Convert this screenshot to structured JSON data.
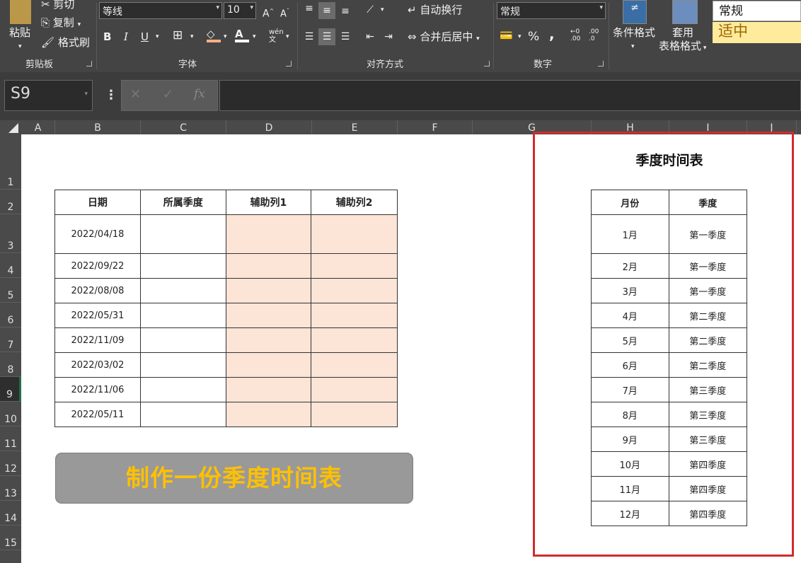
{
  "ribbon": {
    "clipboard": {
      "paste": "粘贴",
      "cut": "剪切",
      "copy": "复制",
      "format_painter": "格式刷",
      "group_label": "剪贴板"
    },
    "font": {
      "family": "等线",
      "size": "10",
      "bold": "B",
      "italic": "I",
      "underline": "U",
      "group_label": "字体"
    },
    "alignment": {
      "wrap_text": "自动换行",
      "merge_center": "合并后居中",
      "group_label": "对齐方式"
    },
    "number": {
      "format": "常规",
      "percent": "%",
      "comma": ",",
      "inc_decimal": ".00",
      "dec_decimal": ".0",
      "group_label": "数字"
    },
    "styles": {
      "conditional_format": "条件格式",
      "table_format_line1": "套用",
      "table_format_line2": "表格格式",
      "style_normal": "常规",
      "style_neutral": "适中"
    }
  },
  "formula_bar": {
    "name_box": "S9",
    "fx": "fx",
    "cancel": "✕",
    "confirm": "✓"
  },
  "columns": [
    "A",
    "B",
    "C",
    "D",
    "E",
    "F",
    "G",
    "H",
    "I",
    "J"
  ],
  "rows": [
    "1",
    "2",
    "3",
    "4",
    "5",
    "6",
    "7",
    "8",
    "9",
    "10",
    "11",
    "12",
    "13",
    "14",
    "15"
  ],
  "main_table": {
    "headers": [
      "日期",
      "所属季度",
      "辅助列1",
      "辅助列2"
    ],
    "dates": [
      "2022/04/18",
      "2022/09/22",
      "2022/08/08",
      "2022/05/31",
      "2022/11/09",
      "2022/03/02",
      "2022/11/06",
      "2022/05/11"
    ]
  },
  "banner_text": "制作一份季度时间表",
  "quarter_table": {
    "title": "季度时间表",
    "headers": [
      "月份",
      "季度"
    ],
    "rows": [
      [
        "1月",
        "第一季度"
      ],
      [
        "2月",
        "第一季度"
      ],
      [
        "3月",
        "第一季度"
      ],
      [
        "4月",
        "第二季度"
      ],
      [
        "5月",
        "第二季度"
      ],
      [
        "6月",
        "第二季度"
      ],
      [
        "7月",
        "第三季度"
      ],
      [
        "8月",
        "第三季度"
      ],
      [
        "9月",
        "第三季度"
      ],
      [
        "10月",
        "第四季度"
      ],
      [
        "11月",
        "第四季度"
      ],
      [
        "12月",
        "第四季度"
      ]
    ]
  },
  "colors": {
    "accent_red": "#d22b2b",
    "banner_text": "#ffc000",
    "helper_fill": "#fce4d6",
    "banner_fill": "#999999"
  }
}
